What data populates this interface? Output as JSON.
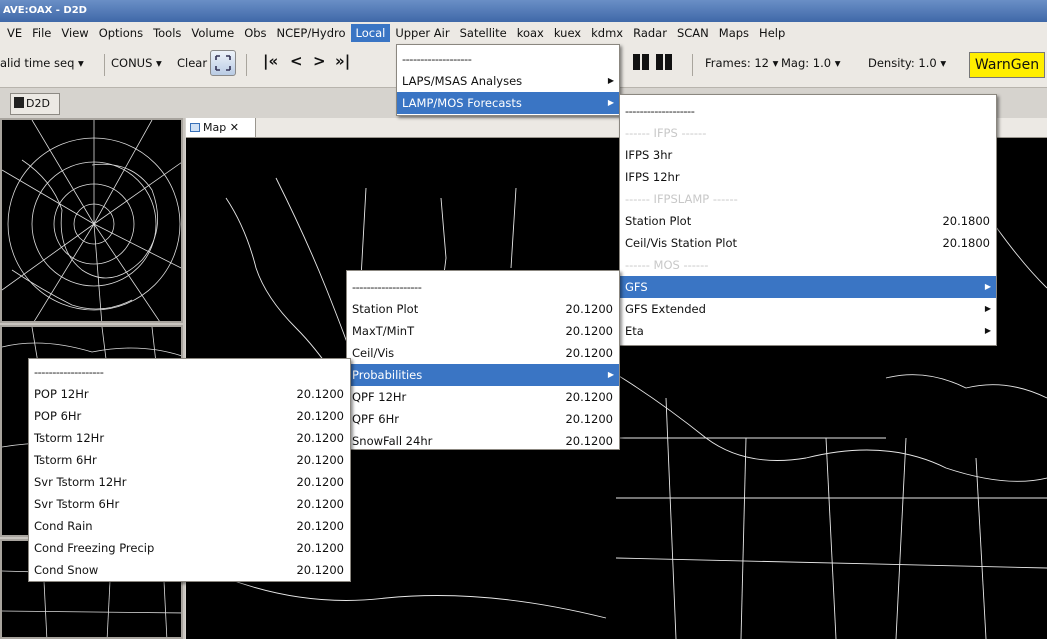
{
  "window": {
    "title": "AVE:OAX - D2D"
  },
  "menubar": [
    "VE",
    "File",
    "View",
    "Options",
    "Tools",
    "Volume",
    "Obs",
    "NCEP/Hydro",
    "Local",
    "Upper Air",
    "Satellite",
    "koax",
    "kuex",
    "kdmx",
    "Radar",
    "SCAN",
    "Maps",
    "Help"
  ],
  "toolbar": {
    "time_seq": "alid time seq ▾",
    "scale": "CONUS ▾",
    "clear": "Clear",
    "first_frame": "|«",
    "prev": "<",
    "next": ">",
    "last_frame": "»|",
    "frames": "Frames: 12 ▾",
    "mag": "Mag: 1.0 ▾",
    "density": "Density: 1.0 ▾",
    "warngen": "WarnGen"
  },
  "perspective_tab": "D2D",
  "editor_tab": "Map",
  "menus": {
    "local": {
      "items": [
        {
          "label": "-------------------",
          "kind": "dash"
        },
        {
          "label": "LAPS/MSAS Analyses",
          "submenu": true
        },
        {
          "label": "LAMP/MOS Forecasts",
          "submenu": true,
          "selected": true
        }
      ]
    },
    "lamp_mos": {
      "items": [
        {
          "label": "-------------------",
          "kind": "dash"
        },
        {
          "label": "------ IFPS ------",
          "kind": "disabled"
        },
        {
          "label": "IFPS 3hr"
        },
        {
          "label": "IFPS 12hr"
        },
        {
          "label": "------ IFPSLAMP ------",
          "kind": "disabled"
        },
        {
          "label": "Station Plot",
          "value": "20.1800"
        },
        {
          "label": "Ceil/Vis Station Plot",
          "value": "20.1800"
        },
        {
          "label": "------ MOS ------",
          "kind": "disabled"
        },
        {
          "label": "GFS",
          "submenu": true,
          "selected": true
        },
        {
          "label": "GFS Extended",
          "submenu": true
        },
        {
          "label": "Eta",
          "submenu": true
        }
      ]
    },
    "gfs": {
      "items": [
        {
          "label": "-------------------",
          "kind": "dash"
        },
        {
          "label": "Station Plot",
          "value": "20.1200"
        },
        {
          "label": "MaxT/MinT",
          "value": "20.1200"
        },
        {
          "label": "Ceil/Vis",
          "value": "20.1200"
        },
        {
          "label": "Probabilities",
          "submenu": true,
          "selected": true
        },
        {
          "label": "QPF 12Hr",
          "value": "20.1200"
        },
        {
          "label": "QPF 6Hr",
          "value": "20.1200"
        },
        {
          "label": "SnowFall 24hr",
          "value": "20.1200"
        }
      ]
    },
    "probabilities": {
      "items": [
        {
          "label": "-------------------",
          "kind": "dash"
        },
        {
          "label": "POP 12Hr",
          "value": "20.1200"
        },
        {
          "label": "POP 6Hr",
          "value": "20.1200"
        },
        {
          "label": "Tstorm 12Hr",
          "value": "20.1200"
        },
        {
          "label": "Tstorm 6Hr",
          "value": "20.1200"
        },
        {
          "label": "Svr Tstorm 12Hr",
          "value": "20.1200"
        },
        {
          "label": "Svr Tstorm 6Hr",
          "value": "20.1200"
        },
        {
          "label": "Cond Rain",
          "value": "20.1200"
        },
        {
          "label": "Cond Freezing Precip",
          "value": "20.1200"
        },
        {
          "label": "Cond Snow",
          "value": "20.1200"
        }
      ]
    }
  }
}
